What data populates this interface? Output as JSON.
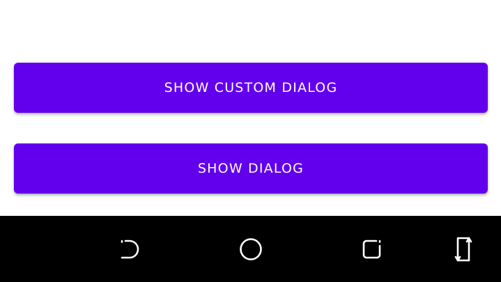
{
  "colors": {
    "accent": "#6200EE",
    "background": "#FFFFFF",
    "navbar": "#000000",
    "button_text": "#FFFFFF"
  },
  "buttons": {
    "custom_dialog_label": "Show Custom Dialog",
    "dialog_label": "Show Dialog"
  },
  "navbar": {
    "icons": [
      "back-icon",
      "home-icon",
      "recents-icon",
      "rotate-icon"
    ]
  }
}
